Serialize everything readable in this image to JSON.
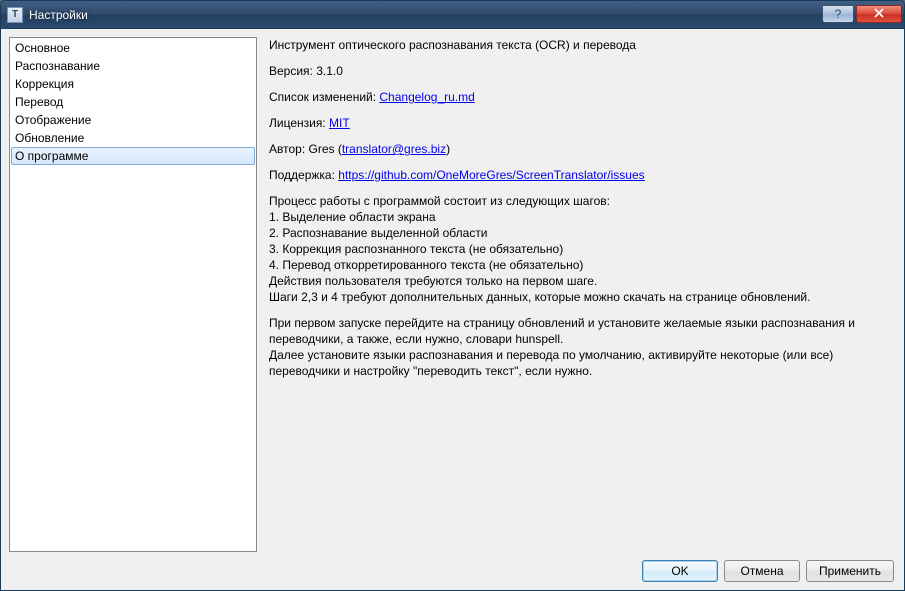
{
  "window": {
    "title": "Настройки",
    "appicon_text": "T"
  },
  "sidebar": {
    "items": [
      {
        "label": "Основное"
      },
      {
        "label": "Распознавание"
      },
      {
        "label": "Коррекция"
      },
      {
        "label": "Перевод"
      },
      {
        "label": "Отображение"
      },
      {
        "label": "Обновление"
      },
      {
        "label": "О программе",
        "selected": true
      }
    ]
  },
  "about": {
    "description": "Инструмент оптического распознавания текста (OCR) и перевода",
    "version_label": "Версия: ",
    "version_value": "3.1.0",
    "changelog_label": "Список изменений: ",
    "changelog_link": "Changelog_ru.md",
    "license_label": "Лицензия: ",
    "license_link": "MIT",
    "author_label": "Автор: ",
    "author_name": "Gres (",
    "author_email": "translator@gres.biz",
    "author_close": ")",
    "support_label": "Поддержка: ",
    "support_link": "https://github.com/OneMoreGres/ScreenTranslator/issues",
    "steps_intro": "Процесс работы с программой состоит из следующих шагов:",
    "step1": "1. Выделение области экрана",
    "step2": "2. Распознавание выделенной области",
    "step3": "3. Коррекция распознанного текста (не обязательно)",
    "step4": "4. Перевод откорретированного текста (не обязательно)",
    "steps_note1": "Действия пользователя требуются только на первом шаге.",
    "steps_note2": "Шаги 2,3 и 4 требуют дополнительных данных, которые можно скачать на странице обновлений.",
    "firstrun1": "При первом запуске перейдите на страницу обновлений и установите желаемые языки распознавания и переводчики, а также, если нужно, словари hunspell.",
    "firstrun2": "Далее установите языки распознавания и перевода по умолчанию, активируйте некоторые (или все) переводчики и настройку \"переводить текст\", если нужно."
  },
  "buttons": {
    "ok": "OK",
    "cancel": "Отмена",
    "apply": "Применить"
  }
}
